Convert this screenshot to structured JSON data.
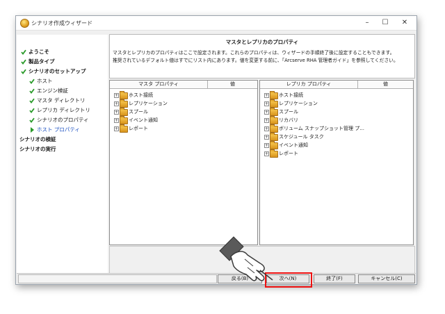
{
  "window": {
    "title": "シナリオ作成ウィザード",
    "minimize": "–",
    "maximize": "☐",
    "close": "✕"
  },
  "sidebar": {
    "items": [
      {
        "label": "ようこそ",
        "status": "done",
        "bold": true
      },
      {
        "label": "製品タイプ",
        "status": "done",
        "bold": true
      },
      {
        "label": "シナリオのセットアップ",
        "status": "done",
        "bold": true
      },
      {
        "label": "ホスト",
        "status": "done",
        "bold": false
      },
      {
        "label": "エンジン検証",
        "status": "done",
        "bold": false
      },
      {
        "label": "マスタ ディレクトリ",
        "status": "done",
        "bold": false
      },
      {
        "label": "レプリカ ディレクトリ",
        "status": "done",
        "bold": false
      },
      {
        "label": "シナリオのプロパティ",
        "status": "done",
        "bold": false
      },
      {
        "label": "ホスト プロパティ",
        "status": "current",
        "bold": false
      },
      {
        "label": "シナリオの検証",
        "status": "pending",
        "bold": true
      },
      {
        "label": "シナリオの実行",
        "status": "pending",
        "bold": true
      }
    ]
  },
  "header": {
    "title": "マスタとレプリカのプロパティ",
    "line1": "マスタとレプリカのプロパティはここで設定されます。これらのプロパティは、ウィザードの手順終了後に設定することもできます。",
    "line2": "推奨されているデフォルト値はすでにリスト内にあります。値を変更する前に、「Arcserve RHA 管理者ガイド」を参照してください。"
  },
  "master_panel": {
    "col_property": "マスタ プロパティ",
    "col_value": "値",
    "items": [
      "ホスト接続",
      "レプリケーション",
      "スプール",
      "イベント通知",
      "レポート"
    ]
  },
  "replica_panel": {
    "col_property": "レプリカ プロパティ",
    "col_value": "値",
    "items": [
      "ホスト接続",
      "レプリケーション",
      "スプール",
      "リカバリ",
      "ボリューム スナップショット管理 プ...",
      "スケジュール タスク",
      "イベント通知",
      "レポート"
    ]
  },
  "buttons": {
    "back": "戻る(B)",
    "next": "次へ(N)",
    "finish": "終了(F)",
    "cancel": "キャンセル(C)"
  },
  "colors": {
    "check": "#2a9a2a",
    "highlight": "#e11111"
  }
}
